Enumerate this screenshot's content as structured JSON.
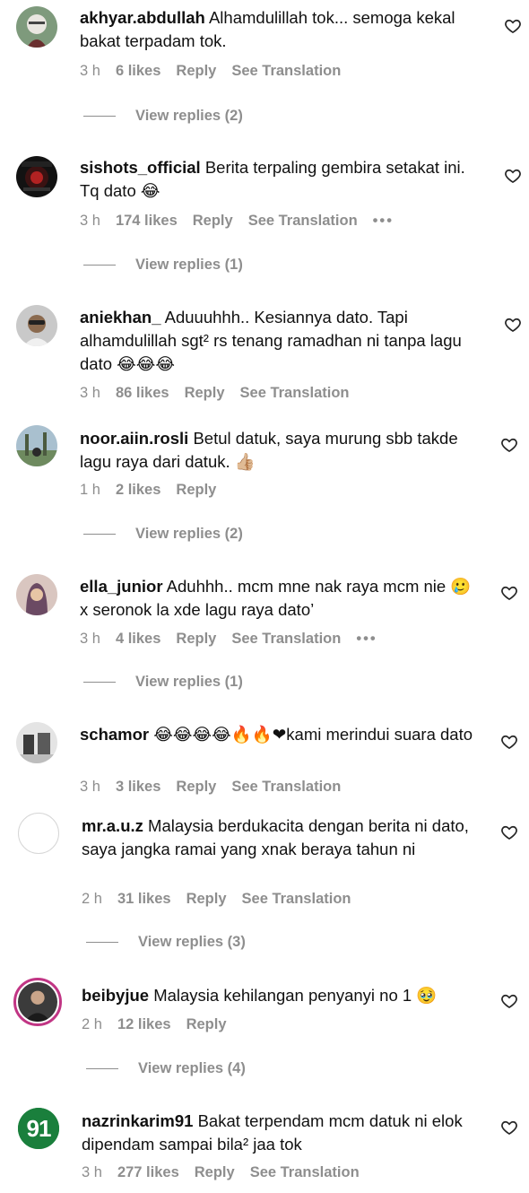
{
  "comments": [
    {
      "username": "akhyar.abdullah",
      "text": "Alhamdulillah tok... semoga kekal bakat terpadam tok.",
      "time": "3 h",
      "likes": "6 likes",
      "reply": "Reply",
      "translate": "See Translation",
      "more": "",
      "view_replies": "View replies (2)"
    },
    {
      "username": "sishots_official",
      "text": "Berita terpaling gembira setakat ini. Tq dato 😂",
      "time": "3 h",
      "likes": "174 likes",
      "reply": "Reply",
      "translate": "See Translation",
      "more": "•••",
      "view_replies": "View replies (1)"
    },
    {
      "username": "aniekhan_",
      "text": "Aduuuhhh.. Kesiannya dato. Tapi alhamdulillah sgt² rs tenang ramadhan ni tanpa lagu dato 😂😂😂",
      "time": "3 h",
      "likes": "86 likes",
      "reply": "Reply",
      "translate": "See Translation",
      "more": "",
      "view_replies": ""
    },
    {
      "username": "noor.aiin.rosli",
      "text": "Betul datuk, saya murung sbb takde lagu raya dari datuk. 👍🏼",
      "time": "1 h",
      "likes": "2 likes",
      "reply": "Reply",
      "translate": "",
      "more": "",
      "view_replies": "View replies (2)"
    },
    {
      "username": "ella_junior",
      "text": "Aduhhh.. mcm mne nak raya mcm nie 🥲 x seronok la xde lagu raya dato’",
      "time": "3 h",
      "likes": "4 likes",
      "reply": "Reply",
      "translate": "See Translation",
      "more": "•••",
      "view_replies": "View replies (1)"
    },
    {
      "username": "schamor",
      "text": "😂😂😂😂🔥🔥❤kami merindui suara dato",
      "time": "3 h",
      "likes": "3 likes",
      "reply": "Reply",
      "translate": "See Translation",
      "more": "",
      "view_replies": ""
    },
    {
      "username": "mr.a.u.z",
      "text": "Malaysia berdukacita dengan berita ni dato, saya jangka ramai yang xnak beraya tahun ni",
      "time": "2 h",
      "likes": "31 likes",
      "reply": "Reply",
      "translate": "See Translation",
      "more": "",
      "view_replies": "View replies (3)"
    },
    {
      "username": "beibyjue",
      "text": "Malaysia kehilangan penyanyi no 1 🥹",
      "time": "2 h",
      "likes": "12 likes",
      "reply": "Reply",
      "translate": "",
      "more": "",
      "view_replies": "View replies (4)"
    },
    {
      "username": "nazrinkarim91",
      "text": "Bakat terpendam mcm datuk ni elok dipendam sampai bila² jaa tok",
      "time": "3 h",
      "likes": "277 likes",
      "reply": "Reply",
      "translate": "See Translation",
      "more": "",
      "view_replies": ""
    }
  ],
  "icons": {
    "like": "heart-outline-icon"
  },
  "colors": {
    "meta_gray": "#8e8e8e",
    "text": "#111111",
    "story_ring": "#c13584"
  }
}
